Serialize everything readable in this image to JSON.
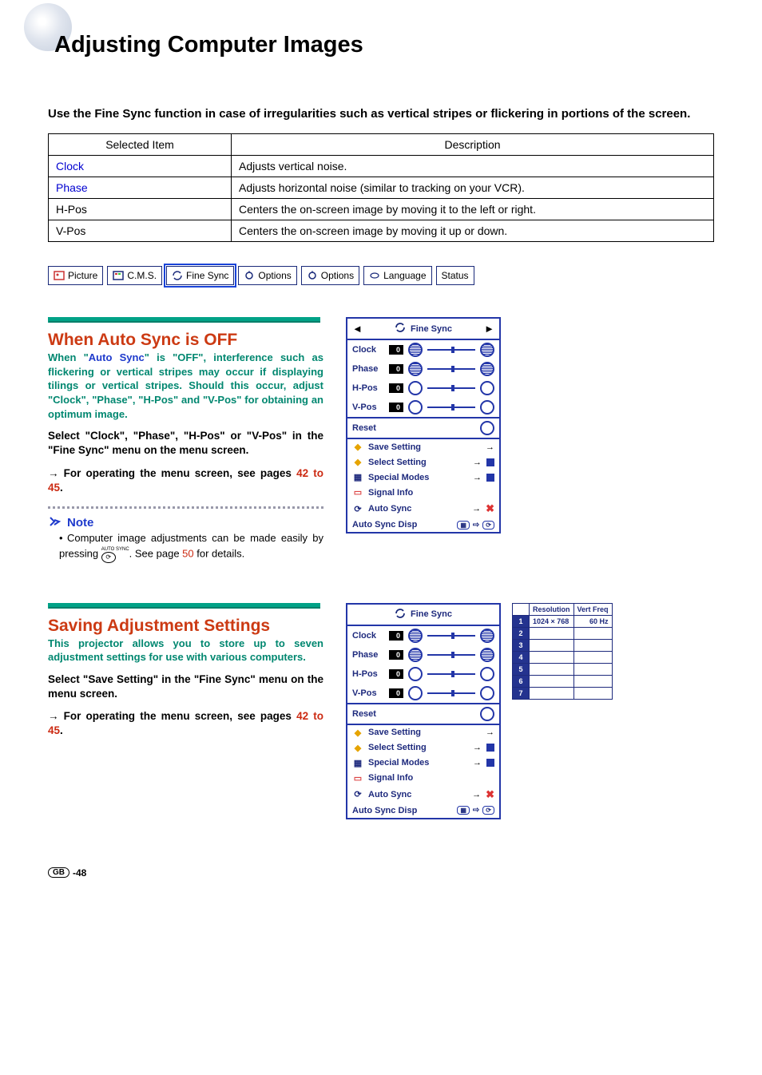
{
  "title": "Adjusting Computer Images",
  "intro": "Use the Fine Sync function in case of irregularities such as vertical stripes or flickering in portions of the screen.",
  "table": {
    "h1": "Selected Item",
    "h2": "Description",
    "rows": [
      {
        "item": "Clock",
        "link": true,
        "desc": "Adjusts vertical noise."
      },
      {
        "item": "Phase",
        "link": true,
        "desc": "Adjusts horizontal noise (similar to tracking on your VCR)."
      },
      {
        "item": "H-Pos",
        "link": false,
        "desc": "Centers the on-screen image by moving it to the left or right."
      },
      {
        "item": "V-Pos",
        "link": false,
        "desc": "Centers the on-screen image by moving it up or down."
      }
    ]
  },
  "tabs": [
    "Picture",
    "C.M.S.",
    "Fine Sync",
    "Options",
    "Options",
    "Language",
    "Status"
  ],
  "section1": {
    "heading": "When Auto Sync is OFF",
    "teal_before": "When \"",
    "teal_link": "Auto Sync",
    "teal_after": "\" is \"OFF\", interference such as flickering or vertical stripes may occur if displaying tilings or vertical stripes. Should this occur, adjust \"Clock\", \"Phase\", \"H-Pos\" and \"V-Pos\" for obtaining an optimum image.",
    "instr1": "Select \"Clock\", \"Phase\", \"H-Pos\" or \"V-Pos\" in the \"Fine Sync\" menu  on the menu screen.",
    "instr2a": "For operating the menu screen, see pages ",
    "instr2b": "42 to 45",
    "instr2c": "."
  },
  "note": {
    "label": "Note",
    "body_a": "Computer image adjustments can be made easily by pressing ",
    "body_b": ". See page ",
    "page": "50",
    "body_c": " for details.",
    "btn": "AUTO SYNC"
  },
  "section2": {
    "heading": "Saving Adjustment Settings",
    "teal": "This projector allows you to store up to seven adjustment settings for use with various computers.",
    "instr1": "Select \"Save Setting\" in the \"Fine Sync\" menu on the menu screen.",
    "instr2a": "For operating the menu screen, see pages ",
    "instr2b": "42 to 45",
    "instr2c": "."
  },
  "osd": {
    "title": "Fine Sync",
    "items": [
      "Clock",
      "Phase",
      "H-Pos",
      "V-Pos"
    ],
    "val": "0",
    "reset": "Reset",
    "rows": [
      "Save Setting",
      "Select Setting",
      "Special Modes",
      "Signal Info",
      "Auto Sync",
      "Auto Sync Disp"
    ]
  },
  "sig": {
    "h1": "Resolution",
    "h2": "Vert Freq",
    "row1a": "1024 × 768",
    "row1b": "60 Hz"
  },
  "footer": {
    "gb": "GB",
    "page": "-48"
  }
}
